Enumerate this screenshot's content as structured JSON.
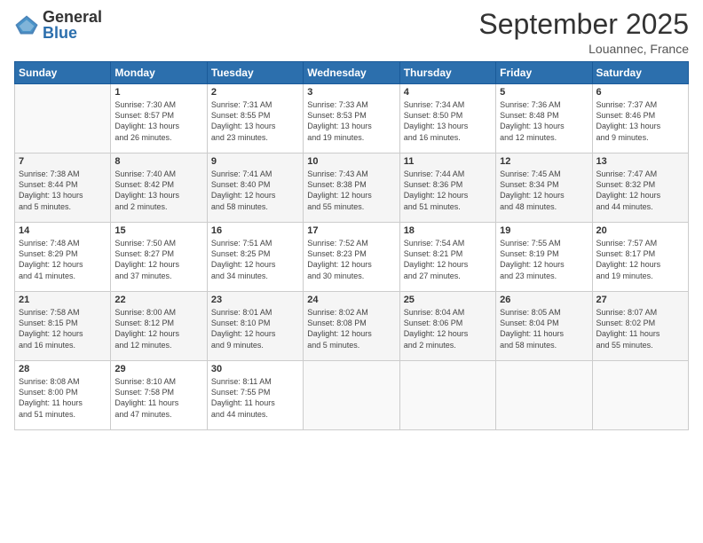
{
  "header": {
    "logo_general": "General",
    "logo_blue": "Blue",
    "month_title": "September 2025",
    "location": "Louannec, France"
  },
  "days_of_week": [
    "Sunday",
    "Monday",
    "Tuesday",
    "Wednesday",
    "Thursday",
    "Friday",
    "Saturday"
  ],
  "weeks": [
    [
      {
        "num": "",
        "info": ""
      },
      {
        "num": "1",
        "info": "Sunrise: 7:30 AM\nSunset: 8:57 PM\nDaylight: 13 hours\nand 26 minutes."
      },
      {
        "num": "2",
        "info": "Sunrise: 7:31 AM\nSunset: 8:55 PM\nDaylight: 13 hours\nand 23 minutes."
      },
      {
        "num": "3",
        "info": "Sunrise: 7:33 AM\nSunset: 8:53 PM\nDaylight: 13 hours\nand 19 minutes."
      },
      {
        "num": "4",
        "info": "Sunrise: 7:34 AM\nSunset: 8:50 PM\nDaylight: 13 hours\nand 16 minutes."
      },
      {
        "num": "5",
        "info": "Sunrise: 7:36 AM\nSunset: 8:48 PM\nDaylight: 13 hours\nand 12 minutes."
      },
      {
        "num": "6",
        "info": "Sunrise: 7:37 AM\nSunset: 8:46 PM\nDaylight: 13 hours\nand 9 minutes."
      }
    ],
    [
      {
        "num": "7",
        "info": "Sunrise: 7:38 AM\nSunset: 8:44 PM\nDaylight: 13 hours\nand 5 minutes."
      },
      {
        "num": "8",
        "info": "Sunrise: 7:40 AM\nSunset: 8:42 PM\nDaylight: 13 hours\nand 2 minutes."
      },
      {
        "num": "9",
        "info": "Sunrise: 7:41 AM\nSunset: 8:40 PM\nDaylight: 12 hours\nand 58 minutes."
      },
      {
        "num": "10",
        "info": "Sunrise: 7:43 AM\nSunset: 8:38 PM\nDaylight: 12 hours\nand 55 minutes."
      },
      {
        "num": "11",
        "info": "Sunrise: 7:44 AM\nSunset: 8:36 PM\nDaylight: 12 hours\nand 51 minutes."
      },
      {
        "num": "12",
        "info": "Sunrise: 7:45 AM\nSunset: 8:34 PM\nDaylight: 12 hours\nand 48 minutes."
      },
      {
        "num": "13",
        "info": "Sunrise: 7:47 AM\nSunset: 8:32 PM\nDaylight: 12 hours\nand 44 minutes."
      }
    ],
    [
      {
        "num": "14",
        "info": "Sunrise: 7:48 AM\nSunset: 8:29 PM\nDaylight: 12 hours\nand 41 minutes."
      },
      {
        "num": "15",
        "info": "Sunrise: 7:50 AM\nSunset: 8:27 PM\nDaylight: 12 hours\nand 37 minutes."
      },
      {
        "num": "16",
        "info": "Sunrise: 7:51 AM\nSunset: 8:25 PM\nDaylight: 12 hours\nand 34 minutes."
      },
      {
        "num": "17",
        "info": "Sunrise: 7:52 AM\nSunset: 8:23 PM\nDaylight: 12 hours\nand 30 minutes."
      },
      {
        "num": "18",
        "info": "Sunrise: 7:54 AM\nSunset: 8:21 PM\nDaylight: 12 hours\nand 27 minutes."
      },
      {
        "num": "19",
        "info": "Sunrise: 7:55 AM\nSunset: 8:19 PM\nDaylight: 12 hours\nand 23 minutes."
      },
      {
        "num": "20",
        "info": "Sunrise: 7:57 AM\nSunset: 8:17 PM\nDaylight: 12 hours\nand 19 minutes."
      }
    ],
    [
      {
        "num": "21",
        "info": "Sunrise: 7:58 AM\nSunset: 8:15 PM\nDaylight: 12 hours\nand 16 minutes."
      },
      {
        "num": "22",
        "info": "Sunrise: 8:00 AM\nSunset: 8:12 PM\nDaylight: 12 hours\nand 12 minutes."
      },
      {
        "num": "23",
        "info": "Sunrise: 8:01 AM\nSunset: 8:10 PM\nDaylight: 12 hours\nand 9 minutes."
      },
      {
        "num": "24",
        "info": "Sunrise: 8:02 AM\nSunset: 8:08 PM\nDaylight: 12 hours\nand 5 minutes."
      },
      {
        "num": "25",
        "info": "Sunrise: 8:04 AM\nSunset: 8:06 PM\nDaylight: 12 hours\nand 2 minutes."
      },
      {
        "num": "26",
        "info": "Sunrise: 8:05 AM\nSunset: 8:04 PM\nDaylight: 11 hours\nand 58 minutes."
      },
      {
        "num": "27",
        "info": "Sunrise: 8:07 AM\nSunset: 8:02 PM\nDaylight: 11 hours\nand 55 minutes."
      }
    ],
    [
      {
        "num": "28",
        "info": "Sunrise: 8:08 AM\nSunset: 8:00 PM\nDaylight: 11 hours\nand 51 minutes."
      },
      {
        "num": "29",
        "info": "Sunrise: 8:10 AM\nSunset: 7:58 PM\nDaylight: 11 hours\nand 47 minutes."
      },
      {
        "num": "30",
        "info": "Sunrise: 8:11 AM\nSunset: 7:55 PM\nDaylight: 11 hours\nand 44 minutes."
      },
      {
        "num": "",
        "info": ""
      },
      {
        "num": "",
        "info": ""
      },
      {
        "num": "",
        "info": ""
      },
      {
        "num": "",
        "info": ""
      }
    ]
  ]
}
